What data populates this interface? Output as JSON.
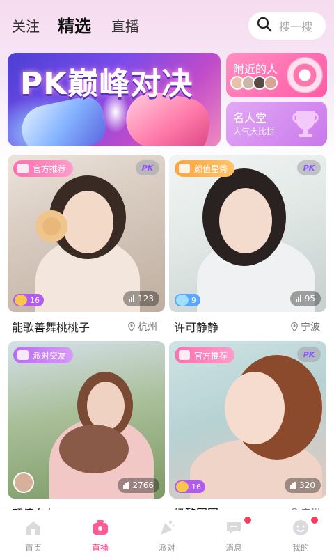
{
  "header": {
    "tabs": [
      {
        "label": "关注"
      },
      {
        "label": "精选"
      },
      {
        "label": "直播"
      }
    ],
    "search_placeholder": "搜一搜"
  },
  "banner": {
    "title": "PK巅峰对决"
  },
  "side_cards": {
    "nearby": {
      "title": "附近的人"
    },
    "hall": {
      "title": "名人堂",
      "subtitle": "人气大比拼"
    }
  },
  "cards": [
    {
      "tag": "官方推荐",
      "badge": "PK",
      "level": "16",
      "viewers": "123",
      "name": "能歌善舞桃桃子",
      "location": "杭州"
    },
    {
      "tag": "颜值星秀",
      "badge": "PK",
      "level": "9",
      "viewers": "95",
      "name": "许可静静",
      "location": "宁波"
    },
    {
      "tag": "派对交友",
      "viewers": "2766",
      "name": "颜值女友"
    },
    {
      "tag": "官方推荐",
      "badge": "PK",
      "level": "16",
      "viewers": "320",
      "name": "奶酪团团",
      "location": "广州"
    }
  ],
  "tabbar": {
    "items": [
      {
        "label": "首页"
      },
      {
        "label": "直播"
      },
      {
        "label": "派对"
      },
      {
        "label": "消息"
      },
      {
        "label": "我的"
      }
    ]
  },
  "colors": {
    "accent": "#ff4d8a",
    "tag_pink": "#ff6fae",
    "tag_orange": "#ffa43a",
    "tag_purple": "#b86cf0"
  }
}
